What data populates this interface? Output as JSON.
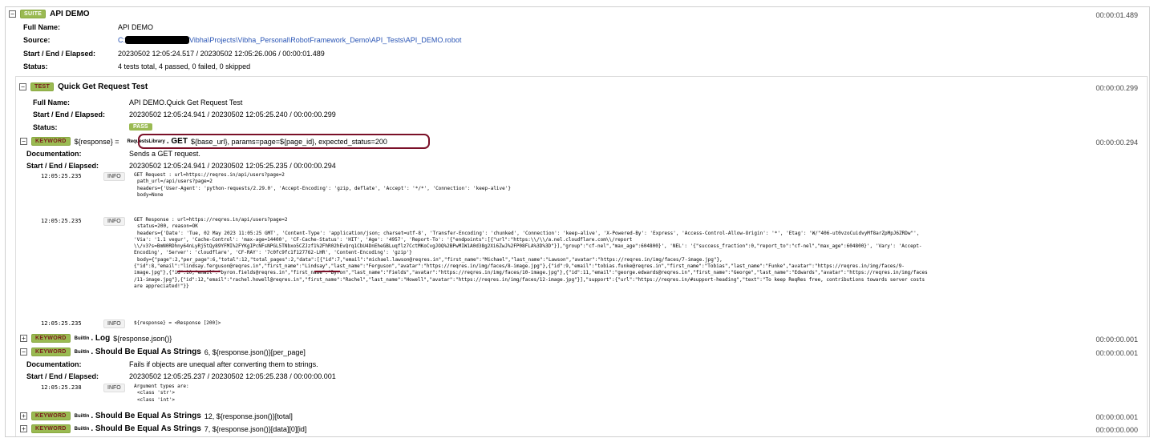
{
  "suite": {
    "badge": "SUITE",
    "name": "API DEMO",
    "elapsed": "00:00:01.489",
    "full_name_label": "Full Name:",
    "full_name": "API DEMO",
    "source_label": "Source:",
    "source_prefix": "C:",
    "source_rest": "Vibha\\Projects\\Vibha_Personal\\RobotFramework_Demo\\API_Tests\\API_DEMO.robot",
    "times_label": "Start / End / Elapsed:",
    "times": "20230502 12:05:24.517 / 20230502 12:05:26.006 / 00:00:01.489",
    "status_label": "Status:",
    "status": "4 tests total, 4 passed, 0 failed, 0 skipped"
  },
  "test": {
    "badge": "TEST",
    "name": "Quick Get Request Test",
    "elapsed": "00:00:00.299",
    "full_name_label": "Full Name:",
    "full_name": "API DEMO.Quick Get Request Test",
    "times_label": "Start / End / Elapsed:",
    "times": "20230502 12:05:24.941 / 20230502 12:05:25.240 / 00:00:00.299",
    "status_label": "Status:",
    "status": "PASS"
  },
  "kw1": {
    "badge": "KEYWORD",
    "assign": "${response} =",
    "lib": "RequestsLibrary",
    "name": ". GET",
    "args": "${base_url}, params=page=${page_id}, expected_status=200",
    "elapsed": "00:00:00.294",
    "doc_label": "Documentation:",
    "doc": "Sends a GET request.",
    "times_label": "Start / End / Elapsed:",
    "times": "20230502 12:05:24.941 / 20230502 12:05:25.235 / 00:00:00.294",
    "messages": [
      {
        "time": "12:05:25.235",
        "level": "INFO",
        "lines": [
          "GET Request : url=https://reqres.in/api/users?page=2",
          " path_url=/api/users?page=2",
          " headers={'User-Agent': 'python-requests/2.29.0', 'Accept-Encoding': 'gzip, deflate', 'Accept': '*/*', 'Connection': 'keep-alive'}",
          " body=None"
        ]
      },
      {
        "time": "12:05:25.235",
        "level": "INFO",
        "lines": [
          "GET Response : url=https://reqres.in/api/users?page=2",
          " status=200, reason=OK",
          " headers={'Date': 'Tue, 02 May 2023 11:05:25 GMT', 'Content-Type': 'application/json; charset=utf-8', 'Transfer-Encoding': 'chunked', 'Connection': 'keep-alive', 'X-Powered-By': 'Express', 'Access-Control-Allow-Origin': '*', 'Etag': 'W/\"406-ut0vzoCuidvyMf8arZpMpJ6ZRDw\"',",
          "'Via': '1.1 vegur', 'Cache-Control': 'max-age=14400', 'CF-Cache-Status': 'HIT', 'Age': '4957', 'Report-To': '{\"endpoints\":[{\"url\":\"https:\\\\/\\\\/a.nel.cloudflare.com\\\\/report",
          "\\\\/v3?s=BmN0RDhny64nLyRj5tQy89YFMI%2FYKgIPcNFsNPGL5TNbxo5CZJzf1%2FhR02hEvQrq1CbU4DnEheGBLuqflz7CctMKoCvgJOQ%2BPwMIW1A0d38g2Xi6ZwJ%2FP08FLA%3D%3D\"}],\"group\":\"cf-nel\",\"max_age\":604800}', 'NEL': '{\"success_fraction\":0,\"report_to\":\"cf-nel\",\"max_age\":604800}', 'Vary': 'Accept-",
          "Encoding', 'Server': 'cloudflare', 'CF-RAY': '7c0fc9fc1f127762-LHR', 'Content-Encoding': 'gzip'}",
          " body={\"page\":2,\"per_page\":6,\"total\":12,\"total_pages\":2,\"data\":[{\"id\":7,\"email\":\"michael.lawson@reqres.in\",\"first_name\":\"Michael\",\"last_name\":\"Lawson\",\"avatar\":\"https://reqres.in/img/faces/7-image.jpg\"},",
          "{\"id\":8,\"email\":\"lindsay.ferguson@reqres.in\",\"first_name\":\"Lindsay\",\"last_name\":\"Ferguson\",\"avatar\":\"https://reqres.in/img/faces/8-image.jpg\"},{\"id\":9,\"email\":\"tobias.funke@reqres.in\",\"first_name\":\"Tobias\",\"last_name\":\"Funke\",\"avatar\":\"https://reqres.in/img/faces/9-",
          "image.jpg\"},{\"id\":10,\"email\":\"byron.fields@reqres.in\",\"first_name\":\"Byron\",\"last_name\":\"Fields\",\"avatar\":\"https://reqres.in/img/faces/10-image.jpg\"},{\"id\":11,\"email\":\"george.edwards@reqres.in\",\"first_name\":\"George\",\"last_name\":\"Edwards\",\"avatar\":\"https://reqres.in/img/faces",
          "/11-image.jpg\"},{\"id\":12,\"email\":\"rachel.howell@reqres.in\",\"first_name\":\"Rachel\",\"last_name\":\"Howell\",\"avatar\":\"https://reqres.in/img/faces/12-image.jpg\"}],\"support\":{\"url\":\"https://reqres.in/#support-heading\",\"text\":\"To keep ReqRes free, contributions towards server costs",
          "are appreciated!\"}}"
        ]
      },
      {
        "time": "12:05:25.235",
        "level": "INFO",
        "lines": [
          "${response} = <Response [200]>"
        ]
      }
    ]
  },
  "kw2": {
    "badge": "KEYWORD",
    "lib": "BuiltIn",
    "name": ". Log",
    "args": "${response.json()}",
    "elapsed": "00:00:00.001"
  },
  "kw3": {
    "badge": "KEYWORD",
    "lib": "BuiltIn",
    "name": ". Should Be Equal As Strings",
    "args": "6, ${response.json()}[per_page]",
    "elapsed": "00:00:00.001",
    "doc_label": "Documentation:",
    "doc": "Fails if objects are unequal after converting them to strings.",
    "times_label": "Start / End / Elapsed:",
    "times": "20230502 12:05:25.237 / 20230502 12:05:25.238 / 00:00:00.001",
    "message": {
      "time": "12:05:25.238",
      "level": "INFO",
      "lines": [
        "Argument types are:",
        "<class 'str'>",
        "<class 'int'>"
      ]
    }
  },
  "kw4": {
    "badge": "KEYWORD",
    "lib": "BuiltIn",
    "name": ". Should Be Equal As Strings",
    "args": "12, ${response.json()}[total]",
    "elapsed": "00:00:00.001"
  },
  "kw5": {
    "badge": "KEYWORD",
    "lib": "BuiltIn",
    "name": ". Should Be Equal As Strings",
    "args": "7, ${response.json()}[data][0][id]",
    "elapsed": "00:00:00.000"
  },
  "toggles": {
    "expanded": "−",
    "collapsed": "+"
  },
  "colors": {
    "badge_green": "#9aba52",
    "highlight": "#7a1028",
    "link": "#2a55b5"
  }
}
